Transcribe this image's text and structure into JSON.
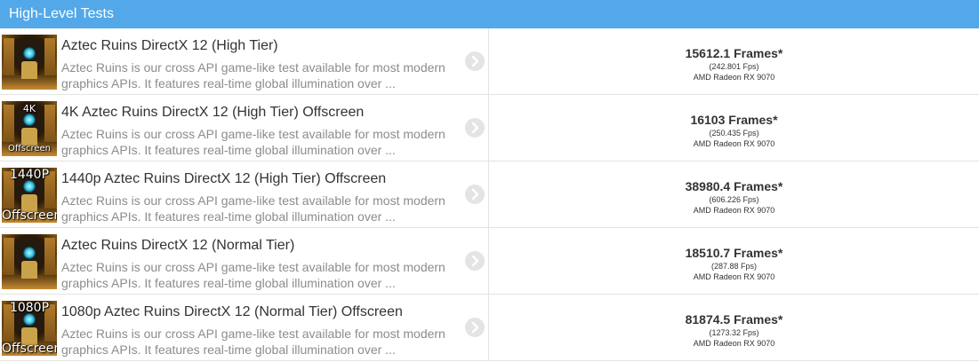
{
  "header": {
    "title": "High-Level Tests"
  },
  "colors": {
    "header_bg": "#52a8e8",
    "title_text": "#333333",
    "desc_text": "#8c8c8c"
  },
  "tests": [
    {
      "thumb_top": "",
      "thumb_bottom": "",
      "title": "Aztec Ruins DirectX 12 (High Tier)",
      "description": "Aztec Ruins is our cross API game-like test available for most modern graphics APIs. It features real-time global illumination over ...",
      "score": "15612.1 Frames*",
      "fps": "(242.801 Fps)",
      "gpu": "AMD Radeon RX 9070"
    },
    {
      "thumb_top": "4K",
      "thumb_bottom": "Offscreen",
      "title": "4K Aztec Ruins DirectX 12 (High Tier) Offscreen",
      "description": "Aztec Ruins is our cross API game-like test available for most modern graphics APIs. It features real-time global illumination over ...",
      "score": "16103 Frames*",
      "fps": "(250.435 Fps)",
      "gpu": "AMD Radeon RX 9070"
    },
    {
      "thumb_top": "1440P",
      "thumb_bottom": "Offscreen",
      "title": "1440p Aztec Ruins DirectX 12 (High Tier) Offscreen",
      "description": "Aztec Ruins is our cross API game-like test available for most modern graphics APIs. It features real-time global illumination over ...",
      "score": "38980.4 Frames*",
      "fps": "(606.226 Fps)",
      "gpu": "AMD Radeon RX 9070"
    },
    {
      "thumb_top": "",
      "thumb_bottom": "",
      "title": "Aztec Ruins DirectX 12 (Normal Tier)",
      "description": "Aztec Ruins is our cross API game-like test available for most modern graphics APIs. It features real-time global illumination over ...",
      "score": "18510.7 Frames*",
      "fps": "(287.88 Fps)",
      "gpu": "AMD Radeon RX 9070"
    },
    {
      "thumb_top": "1080P",
      "thumb_bottom": "Offscreen",
      "title": "1080p Aztec Ruins DirectX 12 (Normal Tier) Offscreen",
      "description": "Aztec Ruins is our cross API game-like test available for most modern graphics APIs. It features real-time global illumination over ...",
      "score": "81874.5 Frames*",
      "fps": "(1273.32 Fps)",
      "gpu": "AMD Radeon RX 9070"
    }
  ]
}
